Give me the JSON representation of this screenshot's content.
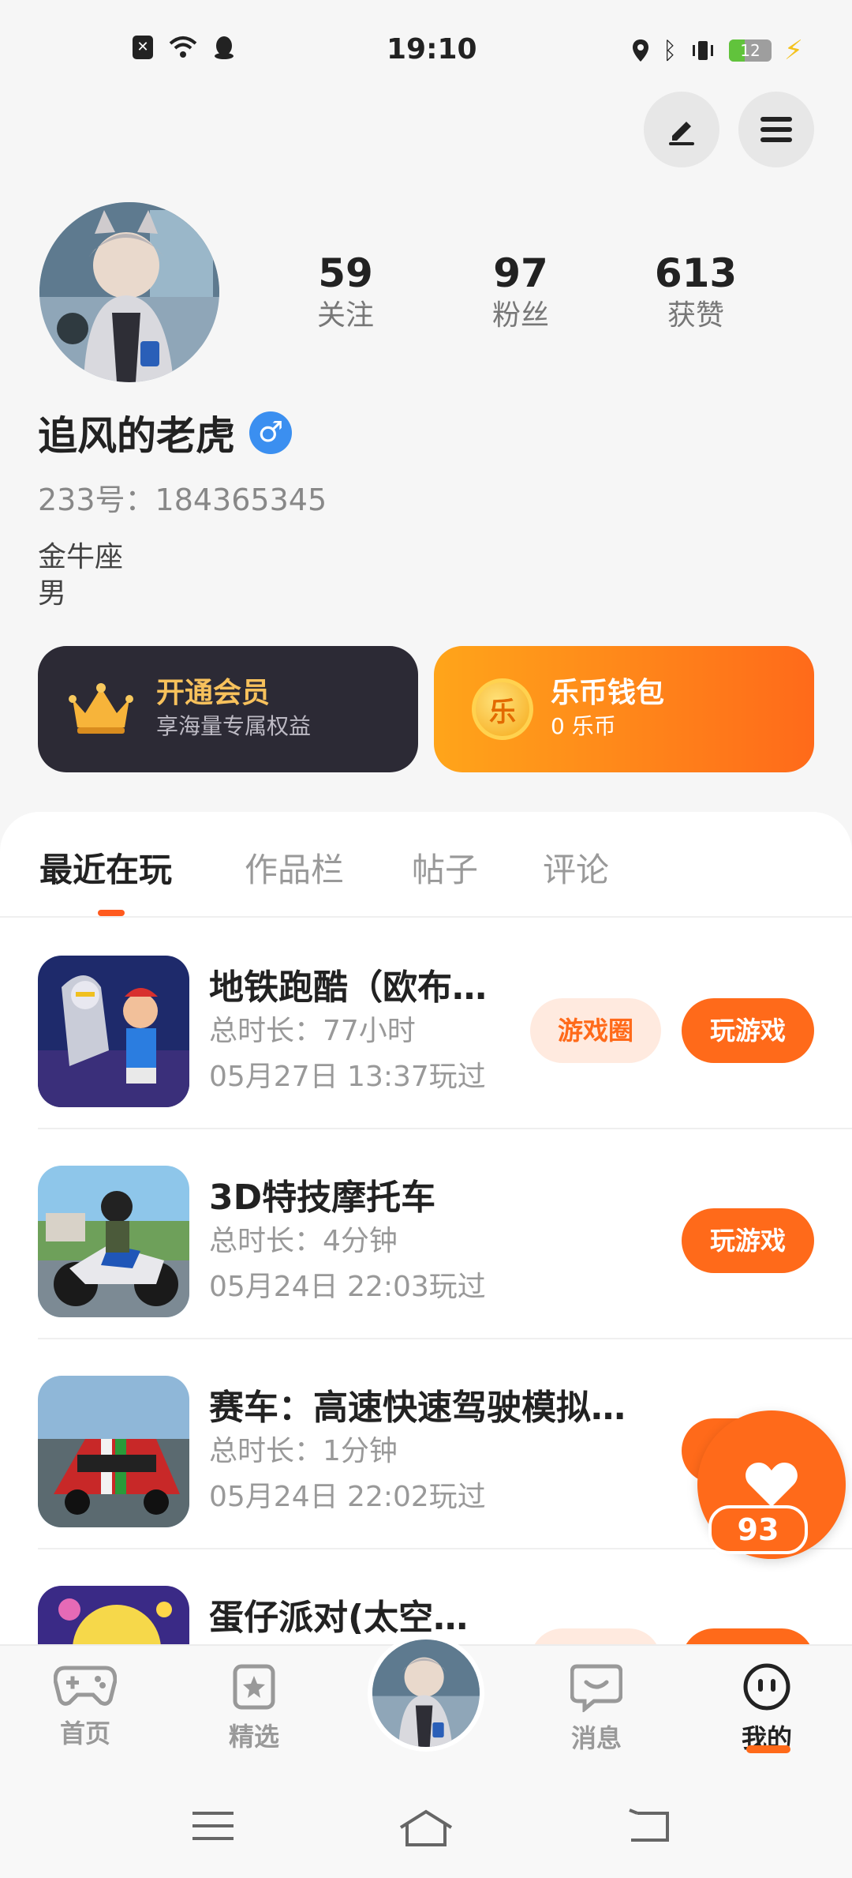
{
  "status_bar": {
    "time": "19:10",
    "battery": "12",
    "icons_left": [
      "notification-x-icon",
      "wifi-icon",
      "qq-penguin-icon"
    ],
    "icons_right": [
      "location-icon",
      "bluetooth-icon",
      "vibrate-icon",
      "battery-icon",
      "charging-icon"
    ]
  },
  "header": {
    "edit_icon": "pencil-icon",
    "menu_icon": "menu-icon"
  },
  "profile": {
    "name": "追风的老虎",
    "gender_symbol": "♂",
    "uid": "233号：184365345",
    "zodiac": "金牛座",
    "gender": "男",
    "stats": [
      {
        "num": "59",
        "label": "关注"
      },
      {
        "num": "97",
        "label": "粉丝"
      },
      {
        "num": "613",
        "label": "获赞"
      }
    ]
  },
  "cards": {
    "vip": {
      "title": "开通会员",
      "sub": "享海量专属权益"
    },
    "wallet": {
      "title": "乐币钱包",
      "sub": "0 乐币",
      "coin_char": "乐"
    }
  },
  "tabs": [
    "最近在玩",
    "作品栏",
    "帖子",
    "评论"
  ],
  "games": [
    {
      "name": "地铁跑酷（欧布…",
      "duration": "总时长：77小时",
      "last": "05月27日 13:37玩过",
      "circle": "游戏圈",
      "play": "玩游戏"
    },
    {
      "name": "3D特技摩托车",
      "duration": "总时长：4分钟",
      "last": "05月24日 22:03玩过",
      "play": "玩游戏"
    },
    {
      "name": "赛车：高速快速驾驶模拟…",
      "duration": "总时长：1分钟",
      "last": "05月24日 22:02玩过"
    },
    {
      "name": "蛋仔派对(太空…"
    }
  ],
  "like_fab": {
    "count": "93"
  },
  "bottom_nav": [
    {
      "label": "首页",
      "icon": "gamepad-icon"
    },
    {
      "label": "精选",
      "icon": "star-card-icon"
    },
    {
      "label": "消息",
      "icon": "chat-bubble-icon"
    },
    {
      "label": "我的",
      "icon": "face-icon"
    }
  ],
  "colors": {
    "accent": "#ff6a1a",
    "vip_bg": "#2c2a35",
    "vip_text": "#f7c15c",
    "male_badge": "#3b8ff0"
  }
}
